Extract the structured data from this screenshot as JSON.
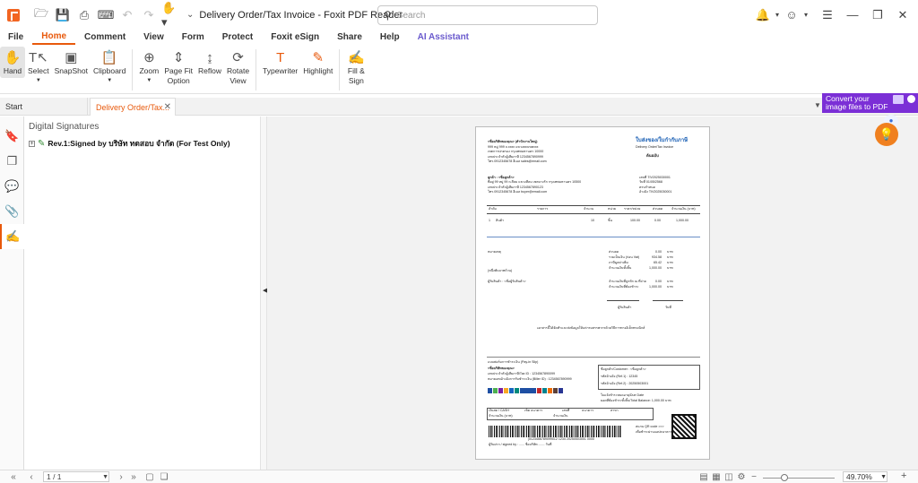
{
  "app": {
    "title": "Delivery Order/Tax Invoice - Foxit PDF Reader"
  },
  "search": {
    "placeholder": "Search"
  },
  "menu": {
    "items": [
      "File",
      "Home",
      "Comment",
      "View",
      "Form",
      "Protect",
      "Foxit eSign",
      "Share",
      "Help",
      "AI Assistant"
    ],
    "active": "Home"
  },
  "ribbon": {
    "hand": "Hand",
    "select": "Select",
    "snapshot": "SnapShot",
    "clipboard": "Clipboard",
    "zoom": "Zoom",
    "page_fit": "Page Fit",
    "page_fit_2": "Option",
    "reflow": "Reflow",
    "rotate": "Rotate",
    "rotate_2": "View",
    "typewriter": "Typewriter",
    "highlight": "Highlight",
    "fill": "Fill &",
    "fill_2": "Sign"
  },
  "tabs": {
    "start": "Start",
    "doc": "Delivery Order/Tax..."
  },
  "promo": {
    "line1": "Convert your",
    "line2": "image files to PDF"
  },
  "panel": {
    "title": "Digital Signatures",
    "signature": "Rev.1:Signed by บริษัท ทดสอบ จำกัด (For Test Only)"
  },
  "document": {
    "company": "<ชื่อบริษัทของคุณ> (สำนักงานใหญ่)",
    "address1": "999 หมู่ 999 ถ.xxxx แขวงxxxเขตxxx",
    "address2": "เขตการปกครอง กรุงเทพมหานคร 10000",
    "taxid": "เลขประจำตัวผู้เสียภาษี 1234567890999",
    "tel": "โทร.0912345678 อีเมล sales@email.com",
    "doc_title": "ใบส่งของ/ใบกำกับภาษี",
    "doc_subtitle": "Delivery Order/Tax Invoice",
    "original": "ต้นฉบับ",
    "customer": "ลูกค้า : <ชื่อลูกค้า>",
    "cust_addr": "ที่อยู่ 99 หมู่ 99 ถ.สีลม แขวงสีลม เขตบางรัก กรุงเทพมหานคร 10500",
    "cust_tax": "เลขประจำตัวผู้เสียภาษี 1234567890123",
    "cust_tel": "โทร.0912345678 อีเมล buyer@email.com",
    "doc_no": "เลขที่ TIV2025030001",
    "doc_date": "วันที่ 01/05/2568",
    "due": "ครบกำหนด",
    "ref": "อ้างอิง TIV2025030001",
    "table_headers": [
      "ลำดับ",
      "รายการ",
      "จำนวน",
      "หน่วย",
      "ราคา/หน่วย",
      "ส่วนลด",
      "จำนวนเงิน (บาท)"
    ],
    "row1": [
      "1",
      "สินค้า",
      "10",
      "ชิ้น",
      "100.00",
      "0.00",
      "1,000.00"
    ],
    "note_label": "หมายเหตุ",
    "sum_labels": [
      "ส่วนลด",
      "รวมเป็นเงิน (ก่อน Vat)",
      "ภาษีมูลค่าเพิ่ม",
      "จำนวนเงินทั้งสิ้น"
    ],
    "sum_values": [
      "0.00",
      "934.58",
      "65.42",
      "1,000.00"
    ],
    "sum_unit": "บาท",
    "amount_text": "(หนึ่งพันบาทถ้วน)",
    "receiver": "ผู้รับสินค้า : <ชื่อผู้รับสินค้า>",
    "paid_labels": [
      "จำนวนเงินที่ถูกหัก ณ ที่จ่าย",
      "จำนวนเงินที่ต้องชำระ"
    ],
    "paid_values": [
      "0.00",
      "1,000.00"
    ],
    "sign_receiver": "ผู้รับสินค้า",
    "sign_date": "วันที่",
    "footer_note": "เอกสารนี้ได้จัดทำและส่งข้อมูลให้แก่กรมสรรพากรด้วยวิธีการทางอิเล็กทรอนิกส์",
    "slip_title": "แบบฟอร์มการชำระเงิน (Pay-in Slip)",
    "slip_company": "<ชื่อบริษัทของคุณ>",
    "slip_tax": "เลขประจำตัวผู้เสียภาษี/Tax ID : 1234567890099",
    "slip_biller": "หมายเลขอ้างอิงการรับชำระเงิน (Biller ID) : 1234567890999",
    "slip_customer": "ชื่อลูกค้า/Customer : <ชื่อลูกค้า>",
    "slip_ref1": "รหัสอ้างอิง (Ref.1) : 12345",
    "slip_ref2": "รหัสอ้างอิง (Ref.2) : 20250503001",
    "slip_due": "ใบแจ้งชำระหมดอายุ/Due Date",
    "slip_total": "ยอดที่ต้องชำระทั้งสิ้น/Total Balance: 1,000.00 บาท",
    "slip_cash": "เงินสด / CASH",
    "slip_cheque": "เช็ค ธนาคาร",
    "slip_cheque_no": "เลขที่",
    "slip_bank": "ธนาคาร",
    "slip_amount": "จำนวนเงิน (บาท)",
    "slip_amount_words": "จำนวนเงิน",
    "slip_branch": "สาขา",
    "slip_qr_note": "สแกน QR code >>>",
    "slip_qr_label": "เพื่อชำระผ่านแอปธนาคาร (Cross Bank)",
    "slip_barcode": "|0123456789099012 1234 20250503001 0000",
    "slip_footer": "ผู้รับฝาก / signed by : ...... ชื่อบริษัท ....... วันที่"
  },
  "status": {
    "page": "1 / 1",
    "zoom": "49.70%"
  }
}
